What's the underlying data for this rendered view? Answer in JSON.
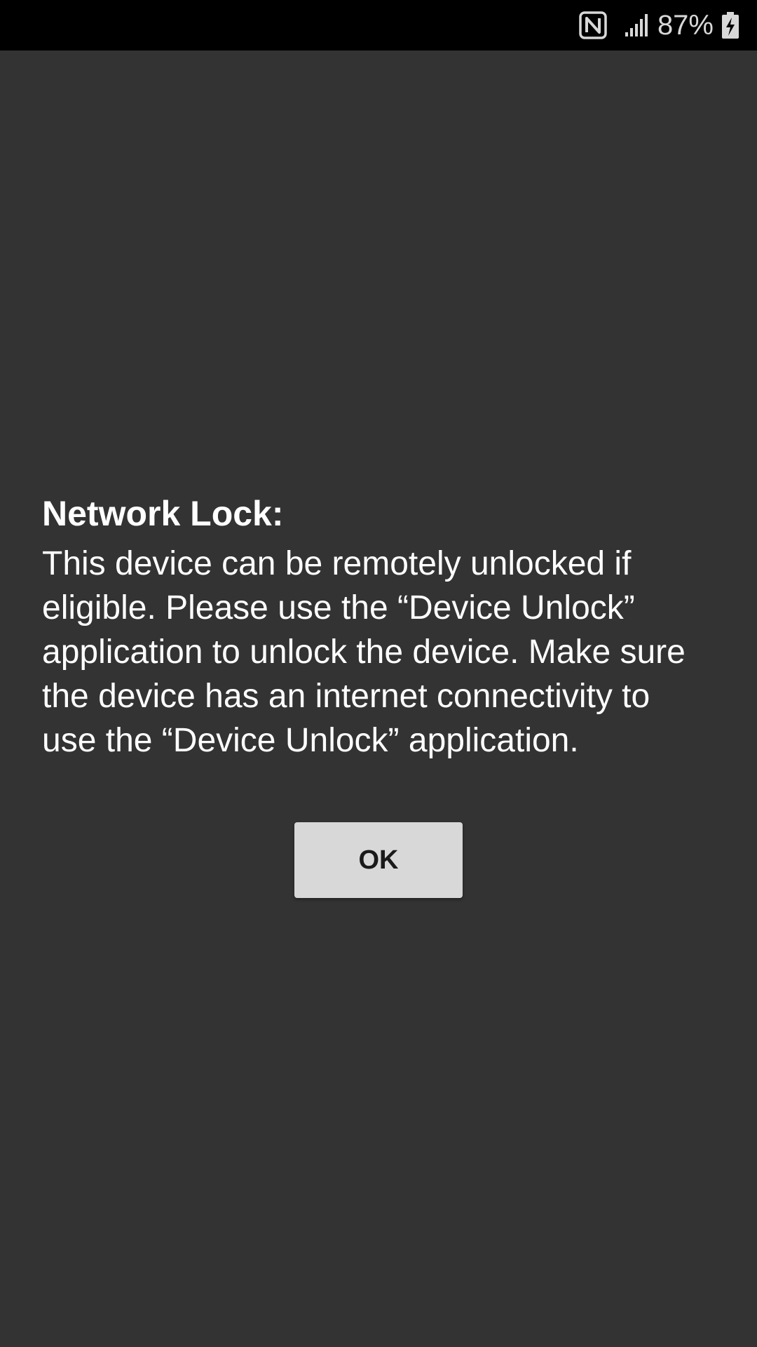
{
  "status_bar": {
    "icons": [
      "nfc-icon",
      "signal-icon",
      "battery-charging-icon"
    ],
    "battery_percent": "87%"
  },
  "dialog": {
    "title": "Network Lock:",
    "message": "This device can be remotely unlocked if eligible. Please use the “Device Unlock” application to unlock the device. Make sure the device has an internet connectivity to use the “Device Unlock” application.",
    "ok_label": "OK"
  },
  "colors": {
    "background": "#333333",
    "status_bar": "#000000",
    "button": "#d8d8d8",
    "text": "#ffffff"
  }
}
